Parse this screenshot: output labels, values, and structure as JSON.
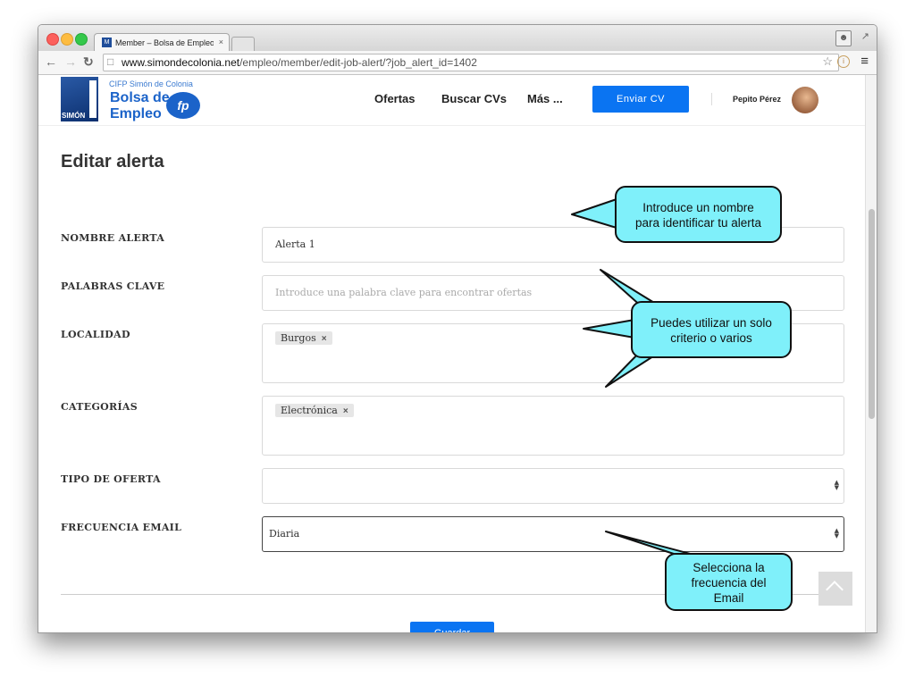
{
  "browser": {
    "tab_title": "Member – Bolsa de Empleo",
    "tab_close": "×",
    "favicon_letter": "M",
    "url_host": "www.simondecolonia.net",
    "url_path": "/empleo/member/edit-job-alert/?job_alert_id=1402"
  },
  "site": {
    "logo": {
      "school": "CIFP Simón de Colonia",
      "line1": "Bolsa de",
      "line2": "Empleo",
      "badge": "fp",
      "emblem_text": "SIMÓN"
    },
    "nav": {
      "ofertas": "Ofertas",
      "buscar_cvs": "Buscar CVs",
      "mas": "Más ..."
    },
    "cta_label": "Enviar CV",
    "user_name": "Pepito Pérez"
  },
  "form": {
    "title": "Editar alerta",
    "fields": {
      "nombre": {
        "label": "NOMBRE ALERTA",
        "value": "Alerta 1"
      },
      "palabras": {
        "label": "PALABRAS CLAVE",
        "placeholder": "Introduce una palabra clave para encontrar ofertas"
      },
      "localidad": {
        "label": "LOCALIDAD",
        "chip": "Burgos",
        "chip_remove": "×"
      },
      "categorias": {
        "label": "CATEGORÍAS",
        "chip": "Electrónica",
        "chip_remove": "×"
      },
      "tipo": {
        "label": "TIPO DE OFERTA",
        "value": ""
      },
      "frecuencia": {
        "label": "FRECUENCIA EMAIL",
        "value": "Diaria"
      }
    },
    "save_label": "Guardar"
  },
  "callouts": {
    "nombre": [
      "Introduce un nombre",
      "para identificar tu alerta"
    ],
    "criterio": [
      "Puedes utilizar un solo",
      "criterio o varios"
    ],
    "frecuencia": [
      "Selecciona la",
      "frecuencia del",
      "Email"
    ]
  },
  "colors": {
    "accent": "#0a74f2",
    "callout_fill": "#7ff0fa"
  }
}
